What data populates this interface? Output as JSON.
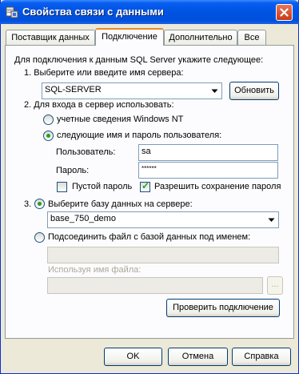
{
  "window": {
    "title": "Свойства связи с данными",
    "icon": "data-link-icon",
    "close_icon": "close-icon"
  },
  "tabs": [
    {
      "label": "Поставщик данных",
      "active": false
    },
    {
      "label": "Подключение",
      "active": true
    },
    {
      "label": "Дополнительно",
      "active": false
    },
    {
      "label": "Все",
      "active": false
    }
  ],
  "connection": {
    "intro": "Для подключения к данным SQL Server укажите следующее:",
    "step1_label": "1. Выберите или введите имя сервера:",
    "server_value": "SQL-SERVER",
    "refresh_button": "Обновить",
    "step2_label": "2. Для входа в сервер использовать:",
    "auth_windows": "учетные сведения Windows NT",
    "auth_sql": "следующие имя и пароль пользователя:",
    "auth_selected": "sql",
    "user_label": "Пользователь:",
    "user_value": "sa",
    "password_label": "Пароль:",
    "password_value": "******",
    "blank_password_label": "Пустой пароль",
    "blank_password_checked": false,
    "save_password_label": "Разрешить сохранение пароля",
    "save_password_checked": true,
    "step3_number": "3.",
    "db_option_label": "Выберите базу данных на сервере:",
    "db_value": "base_750_demo",
    "attach_option_label": "Подсоединить файл с базой данных под именем:",
    "attach_name_value": "",
    "filename_label": "Используя имя файла:",
    "filename_value": "",
    "browse_button": "...",
    "test_button": "Проверить подключение"
  },
  "footer": {
    "ok": "OK",
    "cancel": "Отмена",
    "help": "Справка"
  }
}
